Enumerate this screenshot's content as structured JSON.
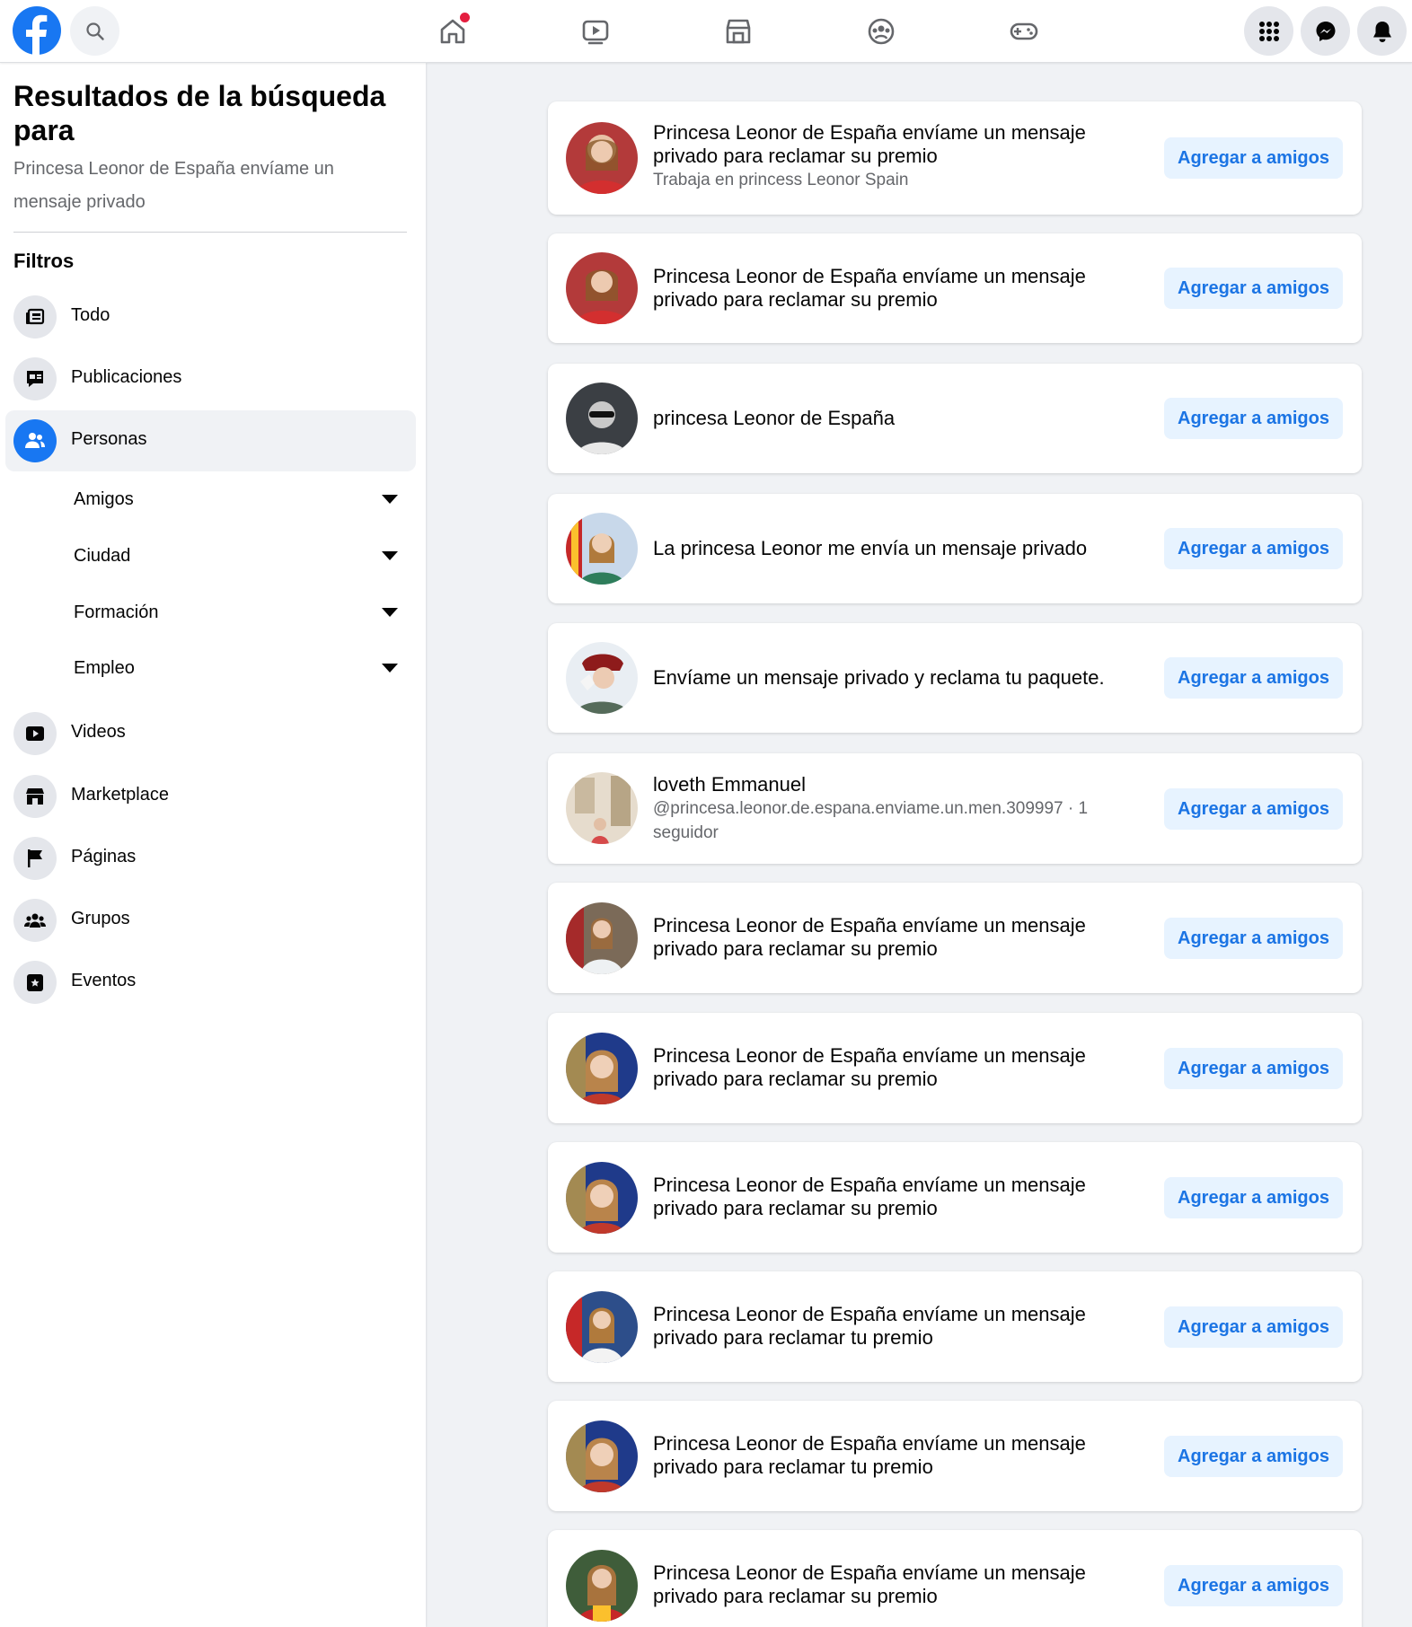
{
  "topnav": {
    "logo_icon": "facebook-logo",
    "search_icon": "search-icon",
    "nav": [
      "home-icon",
      "watch-icon",
      "marketplace-icon",
      "groups-icon",
      "gaming-icon"
    ],
    "right": [
      "menu-grid-icon",
      "messenger-icon",
      "notifications-icon"
    ],
    "home_badge_color": "#e41e3f"
  },
  "sidebar": {
    "title": "Resultados de la búsqueda para",
    "query": "Princesa Leonor de España envíame un mensaje privado",
    "filters_label": "Filtros",
    "items": [
      {
        "label": "Todo",
        "icon": "all-results-icon"
      },
      {
        "label": "Publicaciones",
        "icon": "posts-icon"
      },
      {
        "label": "Personas",
        "icon": "people-icon",
        "active": true
      }
    ],
    "sub_filters": [
      {
        "label": "Amigos"
      },
      {
        "label": "Ciudad"
      },
      {
        "label": "Formación"
      },
      {
        "label": "Empleo"
      }
    ],
    "items_after": [
      {
        "label": "Videos",
        "icon": "video-icon"
      },
      {
        "label": "Marketplace",
        "icon": "shop-icon"
      },
      {
        "label": "Páginas",
        "icon": "flag-icon"
      },
      {
        "label": "Grupos",
        "icon": "groups-icon"
      },
      {
        "label": "Eventos",
        "icon": "calendar-star-icon"
      }
    ]
  },
  "add_friend_label": "Agregar a amigos",
  "results": [
    {
      "name": "Princesa Leonor de España envíame un mensaje privado para reclamar su premio",
      "sub": "Trabaja en princess Leonor Spain"
    },
    {
      "name": "Princesa Leonor de España envíame un mensaje privado para reclamar su premio",
      "sub": ""
    },
    {
      "name": "princesa Leonor de España",
      "sub": ""
    },
    {
      "name": "La princesa Leonor me envía un mensaje privado",
      "sub": ""
    },
    {
      "name": "Envíame un mensaje privado y reclama tu paquete.",
      "sub": ""
    },
    {
      "name": "loveth Emmanuel",
      "sub": "@princesa.leonor.de.espana.enviame.un.men.309997 · 1 seguidor"
    },
    {
      "name": "Princesa Leonor de España envíame un mensaje privado para reclamar su premio",
      "sub": ""
    },
    {
      "name": "Princesa Leonor de España envíame un mensaje privado para reclamar su premio",
      "sub": ""
    },
    {
      "name": "Princesa Leonor de España envíame un mensaje privado para reclamar su premio",
      "sub": ""
    },
    {
      "name": "Princesa Leonor de España envíame un mensaje privado para reclamar tu premio",
      "sub": ""
    },
    {
      "name": "Princesa Leonor de España envíame un mensaje privado para reclamar tu premio",
      "sub": ""
    },
    {
      "name": "Princesa Leonor de España envíame un mensaje privado para reclamar su premio",
      "sub": ""
    }
  ]
}
